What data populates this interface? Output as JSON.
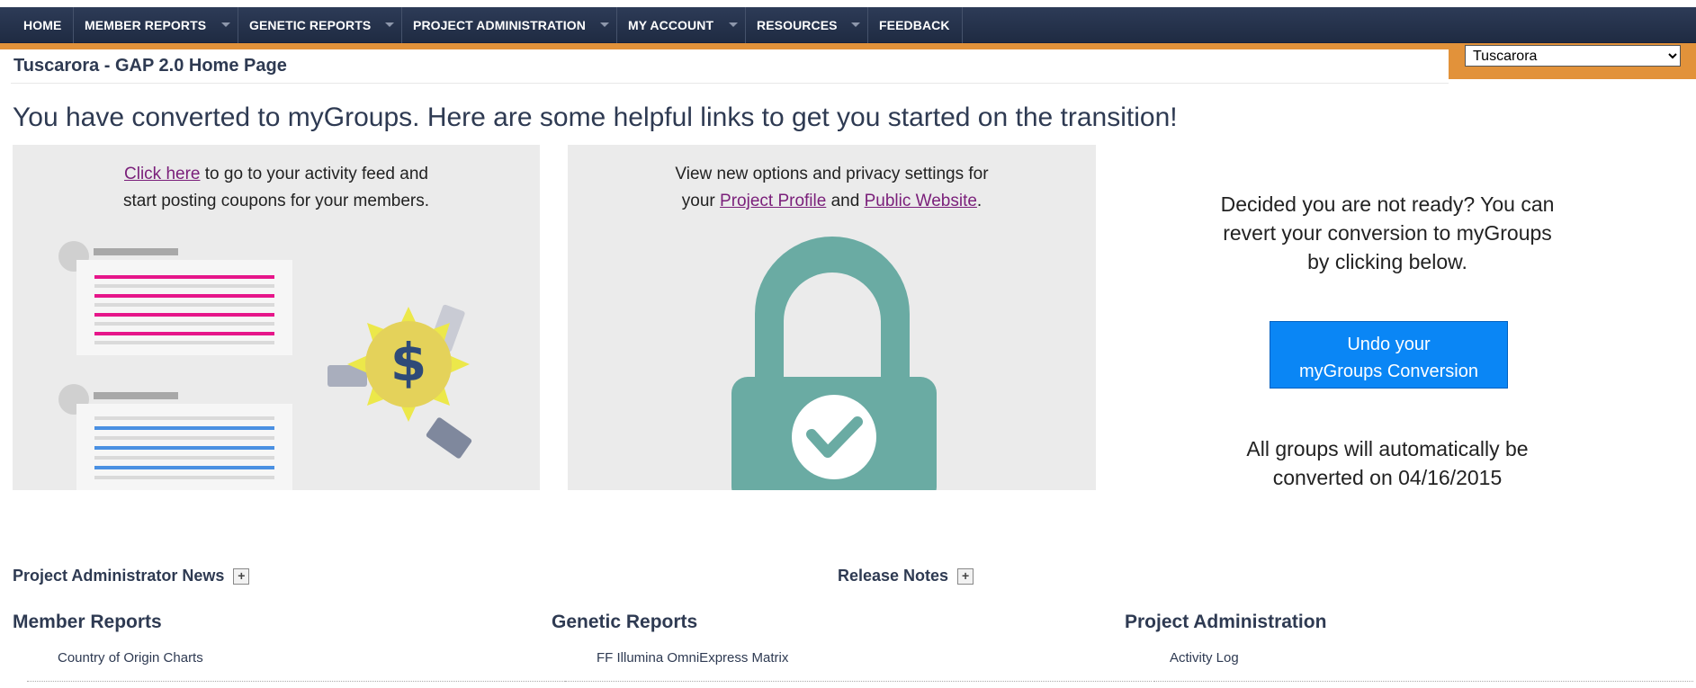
{
  "nav": {
    "items": [
      {
        "label": "HOME"
      },
      {
        "label": "MEMBER REPORTS"
      },
      {
        "label": "GENETIC REPORTS"
      },
      {
        "label": "PROJECT ADMINISTRATION"
      },
      {
        "label": "MY ACCOUNT"
      },
      {
        "label": "RESOURCES"
      },
      {
        "label": "FEEDBACK"
      }
    ]
  },
  "group_selector": {
    "selected": "Tuscarora"
  },
  "page": {
    "title": "Tuscarora - GAP 2.0 Home Page"
  },
  "headline": "You have converted to myGroups. Here are some helpful links to get you started on the transition!",
  "panel_activity": {
    "link": "Click here",
    "text_after_link": " to go to your activity feed and",
    "text_line2": "start posting coupons for your members."
  },
  "panel_privacy": {
    "text_line1": "View new options and privacy settings for",
    "text_prefix": "your ",
    "link_profile": "Project Profile",
    "text_and": " and ",
    "link_website": "Public Website",
    "text_end": "."
  },
  "revert": {
    "line1": "Decided you are not ready? You can",
    "line2": "revert your conversion to myGroups",
    "line3": "by clicking below.",
    "button_line1": "Undo your",
    "button_line2": "myGroups Conversion",
    "auto_line1": "All groups will automatically be",
    "auto_line2": "converted on 04/16/2015"
  },
  "sections": {
    "news": "Project Administrator News",
    "release_notes": "Release Notes",
    "plus": "+"
  },
  "columns": {
    "member_reports": {
      "title": "Member Reports",
      "first_link": "Country of Origin Charts"
    },
    "genetic_reports": {
      "title": "Genetic Reports",
      "first_link": "FF Illumina OmniExpress Matrix"
    },
    "project_admin": {
      "title": "Project Administration",
      "first_link": "Activity Log"
    }
  },
  "colors": {
    "nav_bg": "#1f2b42",
    "accent_orange": "#e2923a",
    "button_blue": "#0a86f5",
    "lock_teal": "#6aaba3",
    "coupon_magenta": "#e6168a",
    "list_blue": "#4a90e2",
    "link_purple": "#7a1f7a"
  },
  "icons": [
    "dollar-icon",
    "lock-icon",
    "checkmark-icon",
    "ticket-icon",
    "dropdown-caret-icon",
    "plus-icon"
  ]
}
